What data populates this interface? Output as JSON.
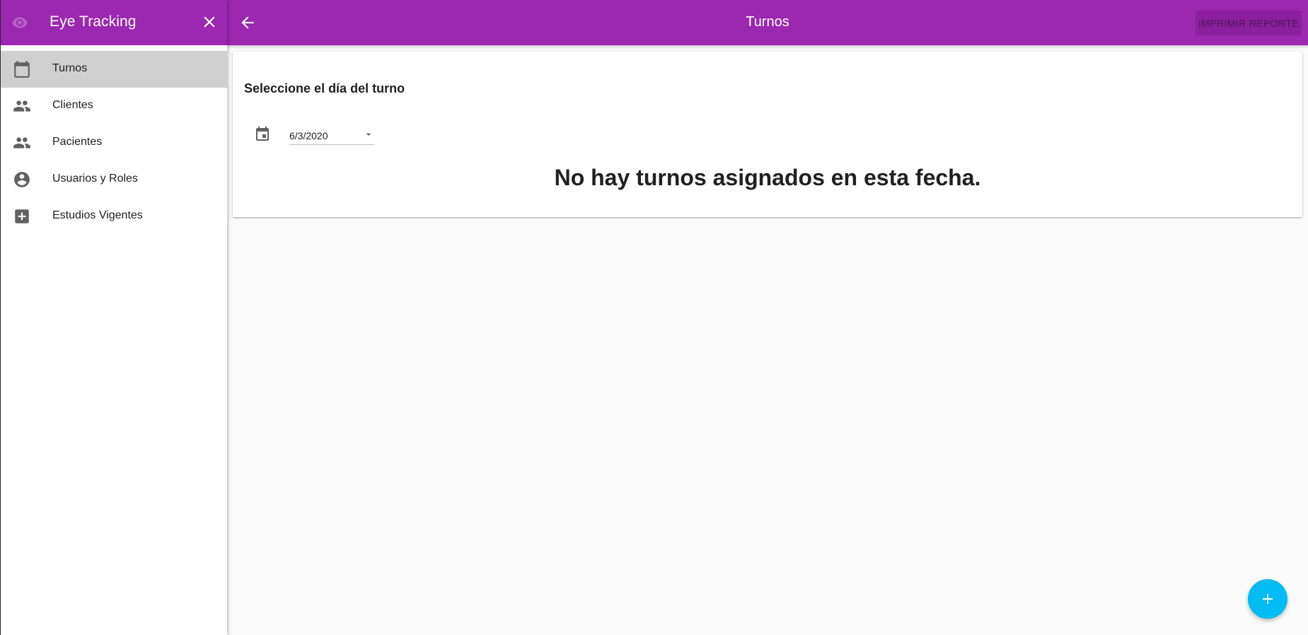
{
  "sidebar": {
    "app_title": "Eye Tracking",
    "items": [
      {
        "label": "Turnos",
        "icon": "calendar-icon",
        "active": true
      },
      {
        "label": "Clientes",
        "icon": "people-icon",
        "active": false
      },
      {
        "label": "Pacientes",
        "icon": "people-icon",
        "active": false
      },
      {
        "label": "Usuarios y Roles",
        "icon": "account-circle-icon",
        "active": false
      },
      {
        "label": "Estudios Vigentes",
        "icon": "medical-plus-icon",
        "active": false
      }
    ]
  },
  "appbar": {
    "title": "Turnos",
    "print_label": "IMPRIMIR REPORTE"
  },
  "main": {
    "card_title": "Seleccione el día del turno",
    "date_value": "6/3/2020",
    "empty_message": "No hay turnos asignados en esta fecha."
  },
  "colors": {
    "primary": "#9c27b0",
    "fab": "#00bcf2",
    "active_item_bg": "#cfcfcf"
  }
}
